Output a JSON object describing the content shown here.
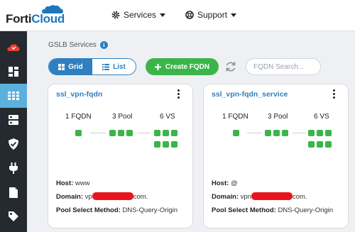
{
  "app": {
    "logo_forti": "Forti",
    "logo_cloud": "Cloud"
  },
  "nav": {
    "services_label": "Services",
    "support_label": "Support"
  },
  "colors": {
    "accent": "#2f7fc1",
    "success": "#3bb54a",
    "sidebar": "#242a30",
    "sidebar_active": "#5bb0dd",
    "redaction": "#e8141b"
  },
  "sidebar": {
    "items": [
      {
        "icon": "cloud-icon",
        "active": false
      },
      {
        "icon": "dashboard-icon",
        "active": false
      },
      {
        "icon": "grid-apps-icon",
        "active": true
      },
      {
        "icon": "server-icon",
        "active": false
      },
      {
        "icon": "shield-icon",
        "active": false
      },
      {
        "icon": "plug-icon",
        "active": false
      },
      {
        "icon": "document-icon",
        "active": false
      }
    ]
  },
  "page": {
    "breadcrumb": "GSLB Services"
  },
  "toolbar": {
    "grid_label": "Grid",
    "list_label": "List",
    "view_selected": "Grid",
    "create_label": "Create FQDN",
    "search_placeholder": "FQDN Search..."
  },
  "cards": [
    {
      "title": "ssl_vpn-fqdn",
      "fqdn_count": "1 FQDN",
      "pool_count": "3 Pool",
      "vs_count": "6 VS",
      "host_label": "Host:",
      "host_value": "www",
      "domain_label": "Domain:",
      "domain_prefix": "vp",
      "domain_suffix": "com.",
      "method_label": "Pool Select Method:",
      "method_value": "DNS-Query-Origin"
    },
    {
      "title": "ssl_vpn-fqdn_service",
      "fqdn_count": "1 FQDN",
      "pool_count": "3 Pool",
      "vs_count": "6 VS",
      "host_label": "Host:",
      "host_value": "@",
      "domain_label": "Domain:",
      "domain_prefix": "vpn",
      "domain_suffix": "com.",
      "method_label": "Pool Select Method:",
      "method_value": "DNS-Query-Origin"
    }
  ]
}
